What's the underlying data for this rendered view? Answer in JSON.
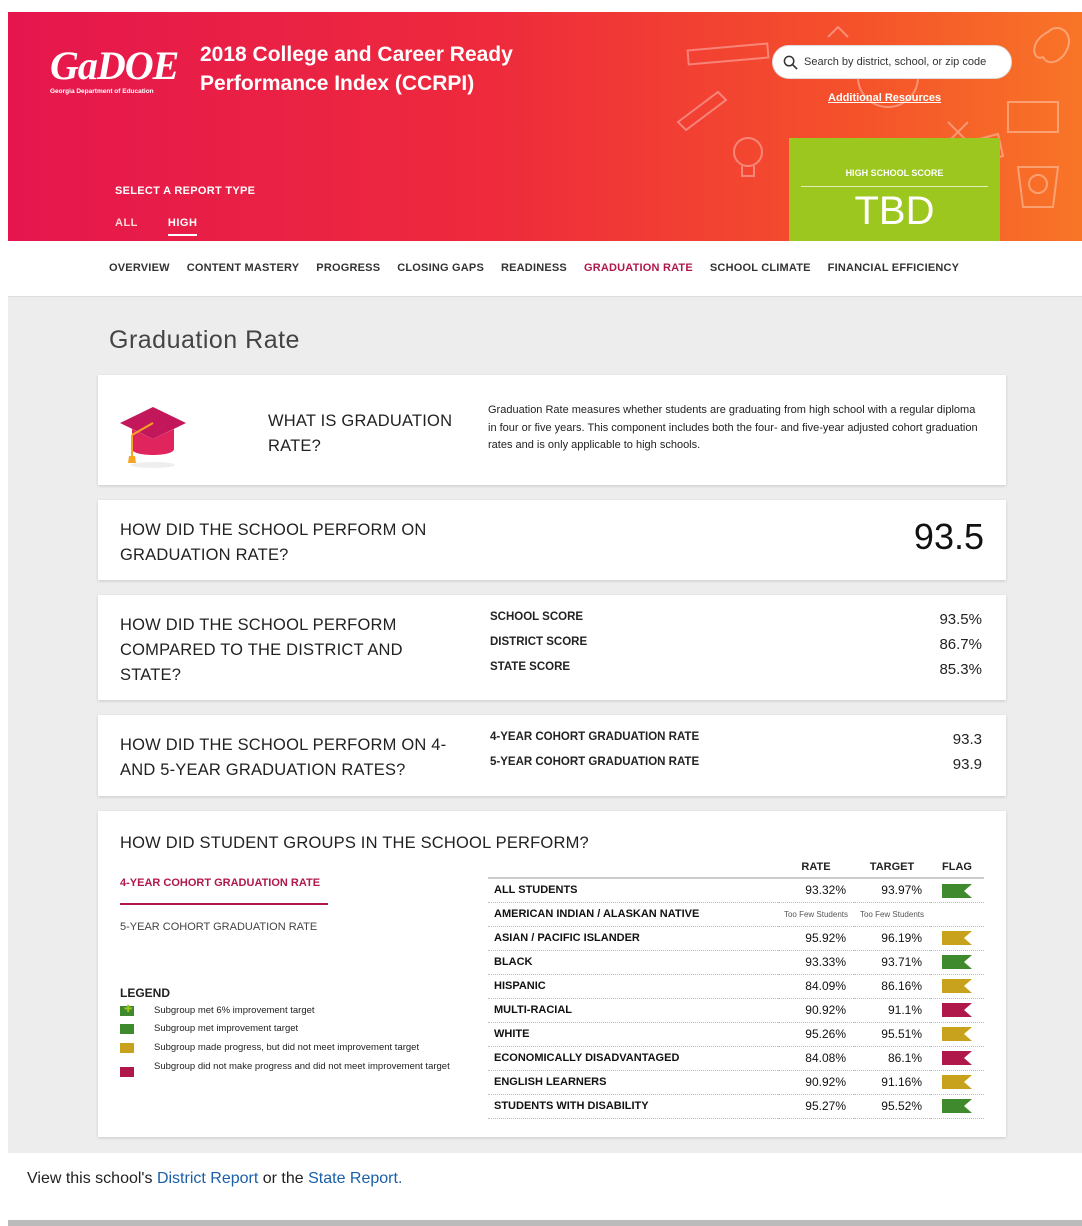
{
  "header": {
    "logo_text": "GaDOE",
    "logo_subtext": "Georgia Department of Education",
    "title_line1": "2018 College and Career Ready",
    "title_line2": "Performance Index (CCRPI)",
    "search_placeholder": "Search by district, school, or zip code",
    "additional_resources": "Additional Resources",
    "report_type_label": "SELECT A REPORT TYPE",
    "report_tabs": [
      "ALL",
      "HIGH"
    ],
    "active_report_tab": "HIGH",
    "score_label": "HIGH SCHOOL SCORE",
    "score_value": "TBD"
  },
  "nav": {
    "items": [
      "OVERVIEW",
      "CONTENT MASTERY",
      "PROGRESS",
      "CLOSING GAPS",
      "READINESS",
      "GRADUATION RATE",
      "SCHOOL CLIMATE",
      "FINANCIAL EFFICIENCY"
    ],
    "active": "GRADUATION RATE"
  },
  "page": {
    "title": "Graduation Rate"
  },
  "what_is": {
    "heading": "WHAT IS GRADUATION RATE?",
    "description": "Graduation Rate measures whether students are graduating from high school with a regular diploma in four or five years. This component includes both the four- and five-year adjusted cohort graduation rates and is only applicable to high schools."
  },
  "perform": {
    "question": "HOW DID THE SCHOOL PERFORM ON GRADUATION RATE?",
    "score": "93.5"
  },
  "compared": {
    "question": "HOW DID THE SCHOOL PERFORM COMPARED TO THE DISTRICT AND STATE?",
    "rows": [
      {
        "label": "SCHOOL SCORE",
        "value": "93.5%"
      },
      {
        "label": "DISTRICT SCORE",
        "value": "86.7%"
      },
      {
        "label": "STATE SCORE",
        "value": "85.3%"
      }
    ]
  },
  "cohort": {
    "question": "HOW DID THE SCHOOL PERFORM ON 4- AND 5-YEAR GRADUATION RATES?",
    "rows": [
      {
        "label": "4-YEAR COHORT GRADUATION RATE",
        "value": "93.3"
      },
      {
        "label": "5-YEAR COHORT GRADUATION RATE",
        "value": "93.9"
      }
    ]
  },
  "groups": {
    "question": "HOW DID STUDENT GROUPS IN THE SCHOOL PERFORM?",
    "tab_4yr": "4-YEAR COHORT GRADUATION RATE",
    "tab_5yr": "5-YEAR COHORT GRADUATION RATE",
    "legend_title": "LEGEND",
    "legend": [
      {
        "text": "Subgroup met 6% improvement target",
        "color": "#3f8a2c"
      },
      {
        "text": "Subgroup met improvement target",
        "color": "#3f8a2c"
      },
      {
        "text": "Subgroup made progress, but did not meet improvement target",
        "color": "#c9a21d"
      },
      {
        "text": "Subgroup did not make progress and did not meet improvement target",
        "color": "#b0174b"
      }
    ],
    "col_rate": "RATE",
    "col_target": "TARGET",
    "col_flag": "FLAG",
    "rows": [
      {
        "group": "ALL STUDENTS",
        "rate": "93.32%",
        "target": "93.97%",
        "flag": "green"
      },
      {
        "group": "AMERICAN INDIAN / ALASKAN NATIVE",
        "rate": "Too Few Students",
        "target": "Too Few Students",
        "flag": "none"
      },
      {
        "group": "ASIAN / PACIFIC ISLANDER",
        "rate": "95.92%",
        "target": "96.19%",
        "flag": "yellow"
      },
      {
        "group": "BLACK",
        "rate": "93.33%",
        "target": "93.71%",
        "flag": "green"
      },
      {
        "group": "HISPANIC",
        "rate": "84.09%",
        "target": "86.16%",
        "flag": "yellow"
      },
      {
        "group": "MULTI-RACIAL",
        "rate": "90.92%",
        "target": "91.1%",
        "flag": "red"
      },
      {
        "group": "WHITE",
        "rate": "95.26%",
        "target": "95.51%",
        "flag": "yellow"
      },
      {
        "group": "ECONOMICALLY DISADVANTAGED",
        "rate": "84.08%",
        "target": "86.1%",
        "flag": "red"
      },
      {
        "group": "ENGLISH LEARNERS",
        "rate": "90.92%",
        "target": "91.16%",
        "flag": "yellow"
      },
      {
        "group": "STUDENTS WITH DISABILITY",
        "rate": "95.27%",
        "target": "95.52%",
        "flag": "green"
      }
    ]
  },
  "footer": {
    "prefix": "View this school's ",
    "district_link": "District Report",
    "middle": " or the ",
    "state_link": "State Report."
  },
  "colors": {
    "accent": "#b0174b",
    "score_green": "#9bc71f",
    "flag_green": "#3f8a2c",
    "flag_yellow": "#c9a21d",
    "flag_red": "#b0174b"
  }
}
